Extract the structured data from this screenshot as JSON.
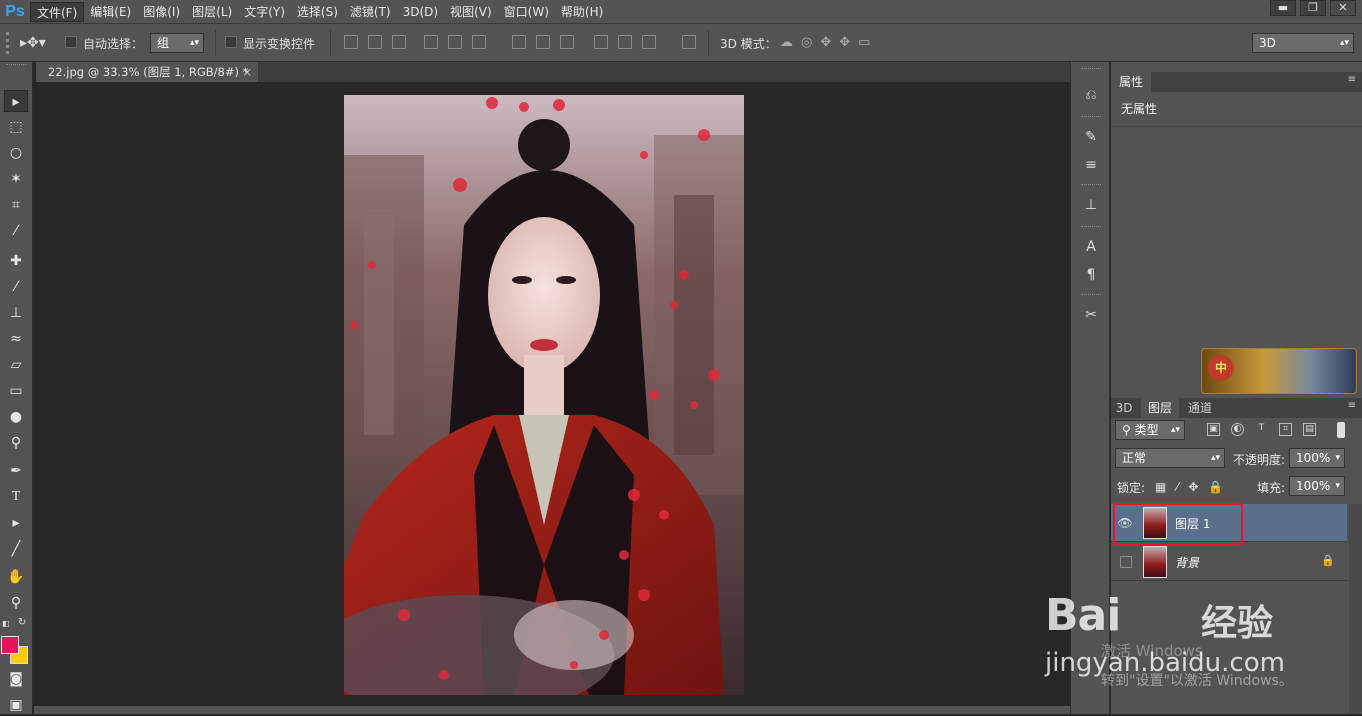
{
  "app": {
    "logo": "Ps"
  },
  "menu": [
    "文件(F)",
    "编辑(E)",
    "图像(I)",
    "图层(L)",
    "文字(Y)",
    "选择(S)",
    "滤镜(T)",
    "3D(D)",
    "视图(V)",
    "窗口(W)",
    "帮助(H)"
  ],
  "window_controls": {
    "minimize": "▬",
    "restore": "❐",
    "close": "✕"
  },
  "options": {
    "auto_select_label": "自动选择：",
    "auto_select_value": "组",
    "show_transform_label": "显示变换控件",
    "mode3d_label": "3D 模式：",
    "workspace_value": "3D"
  },
  "document_tab": {
    "title": "22.jpg @ 33.3% (图层 1, RGB/8#) *",
    "close": "×"
  },
  "properties": {
    "tab": "属性",
    "content": "无属性"
  },
  "layers_panel": {
    "tabs": [
      "3D",
      "图层",
      "通道"
    ],
    "filter_kind": "类型",
    "blend_mode": "正常",
    "opacity_label": "不透明度:",
    "opacity_value": "100%",
    "lock_label": "锁定:",
    "fill_label": "填充:",
    "fill_value": "100%",
    "layers": [
      {
        "name": "图层 1",
        "visible": true,
        "selected": true
      },
      {
        "name": "背景",
        "visible": false,
        "selected": false,
        "locked": true
      }
    ]
  },
  "watermark": {
    "brand": "Bai",
    "brand_suffix": "经验",
    "url": "jingyan.baidu.com",
    "activate_line1": "激活 Windows",
    "activate_line2": "转到\"设置\"以激活 Windows。"
  },
  "icons": {
    "move_tool": "move-icon",
    "eye": "eye-icon",
    "lock": "lock-icon"
  }
}
